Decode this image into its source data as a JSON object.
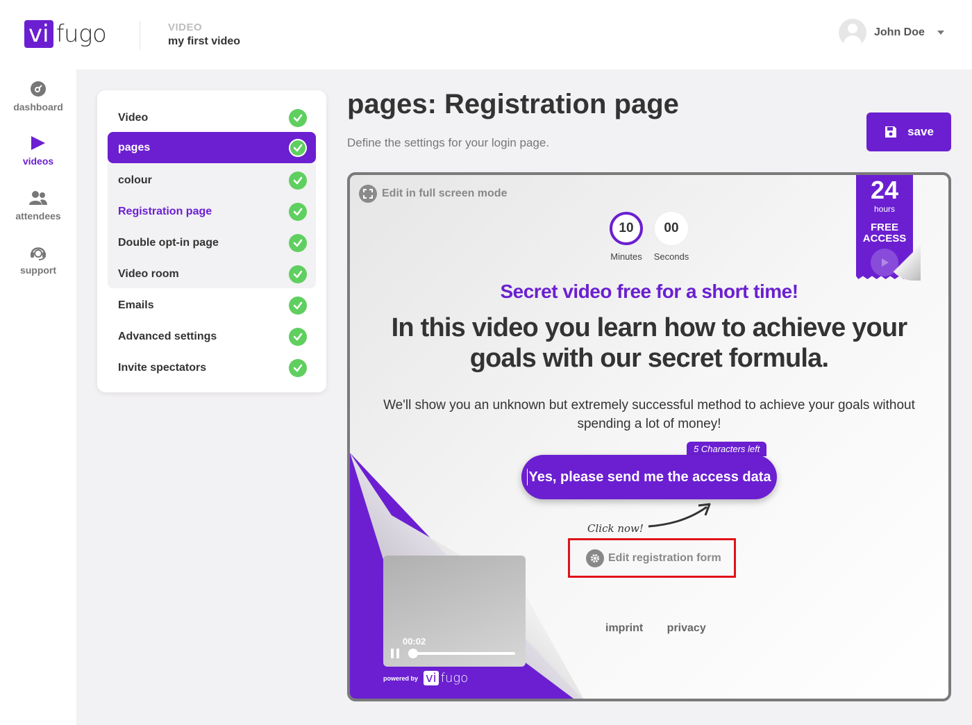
{
  "brand": {
    "logo_vi": "vi",
    "logo_fugo": "fugo",
    "accent": "#6b1fd1",
    "success": "#5fcf60",
    "highlight": "#e0121a"
  },
  "header": {
    "crumb_label": "VIDEO",
    "crumb_title": "my first video",
    "user_name": "John Doe"
  },
  "nav": {
    "items": [
      {
        "label": "dashboard",
        "icon": "dashboard-icon"
      },
      {
        "label": "videos",
        "icon": "play-icon",
        "active": true
      },
      {
        "label": "attendees",
        "icon": "people-icon"
      },
      {
        "label": "support",
        "icon": "headset-icon"
      }
    ]
  },
  "steps": [
    {
      "label": "Video"
    },
    {
      "label": "pages",
      "active": true
    },
    {
      "label": "colour"
    },
    {
      "label": "Registration page",
      "current": true
    },
    {
      "label": "Double opt-in page"
    },
    {
      "label": "Video room"
    },
    {
      "label": "Emails"
    },
    {
      "label": "Advanced settings"
    },
    {
      "label": "Invite spectators"
    }
  ],
  "main": {
    "title": "pages: Registration page",
    "subtitle": "Define the settings for your login page.",
    "save_label": "save"
  },
  "preview": {
    "fullscreen_label": "Edit in full screen mode",
    "timer": {
      "minutes": "10",
      "minutes_label": "Minutes",
      "seconds": "00",
      "seconds_label": "Seconds"
    },
    "ribbon": {
      "number": "24",
      "unit": "hours",
      "line1": "FREE",
      "line2": "ACCESS"
    },
    "headline_purple": "Secret video free for a short time!",
    "headline_main": "In this video you learn how to achieve your goals with our secret formula.",
    "body": "We'll show you an unknown but extremely successful method to achieve your goals without spending a lot of money!",
    "chars_left": "5 Characters left",
    "cta_label": "Yes, please send me the access data",
    "click_now": "Click now!",
    "edit_form_label": "Edit registration form",
    "footer": {
      "imprint": "imprint",
      "privacy": "privacy"
    },
    "video_time": "00:02",
    "powered_by": "powered by"
  }
}
